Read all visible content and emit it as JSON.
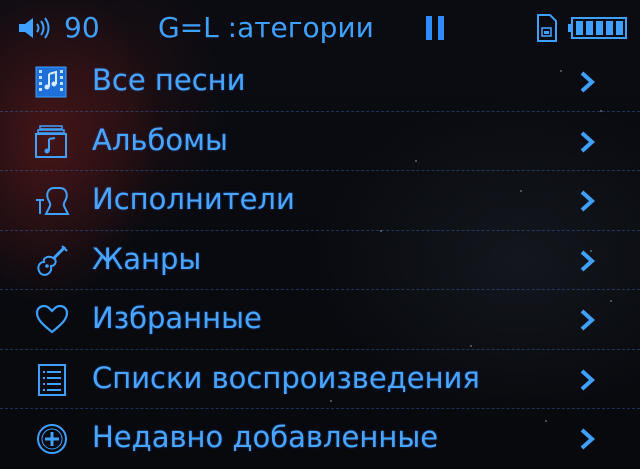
{
  "status_bar": {
    "volume": "90",
    "title": "G=L :атегории",
    "icons": [
      "speaker-icon",
      "pause-icon",
      "sd-card-icon",
      "battery-icon"
    ]
  },
  "menu": {
    "items": [
      {
        "label": "Все песни",
        "icon": "song-list-icon"
      },
      {
        "label": "Альбомы",
        "icon": "album-icon"
      },
      {
        "label": "Исполнители",
        "icon": "artist-icon"
      },
      {
        "label": "Жанры",
        "icon": "guitar-icon"
      },
      {
        "label": "Избранные",
        "icon": "heart-icon"
      },
      {
        "label": "Списки воспроизведения",
        "icon": "playlist-icon"
      },
      {
        "label": "Недавно добавленные",
        "icon": "plus-circle-icon"
      }
    ]
  },
  "colors": {
    "accent": "#3fa0ff",
    "background": "#07090d",
    "divider": "#4682dc"
  }
}
